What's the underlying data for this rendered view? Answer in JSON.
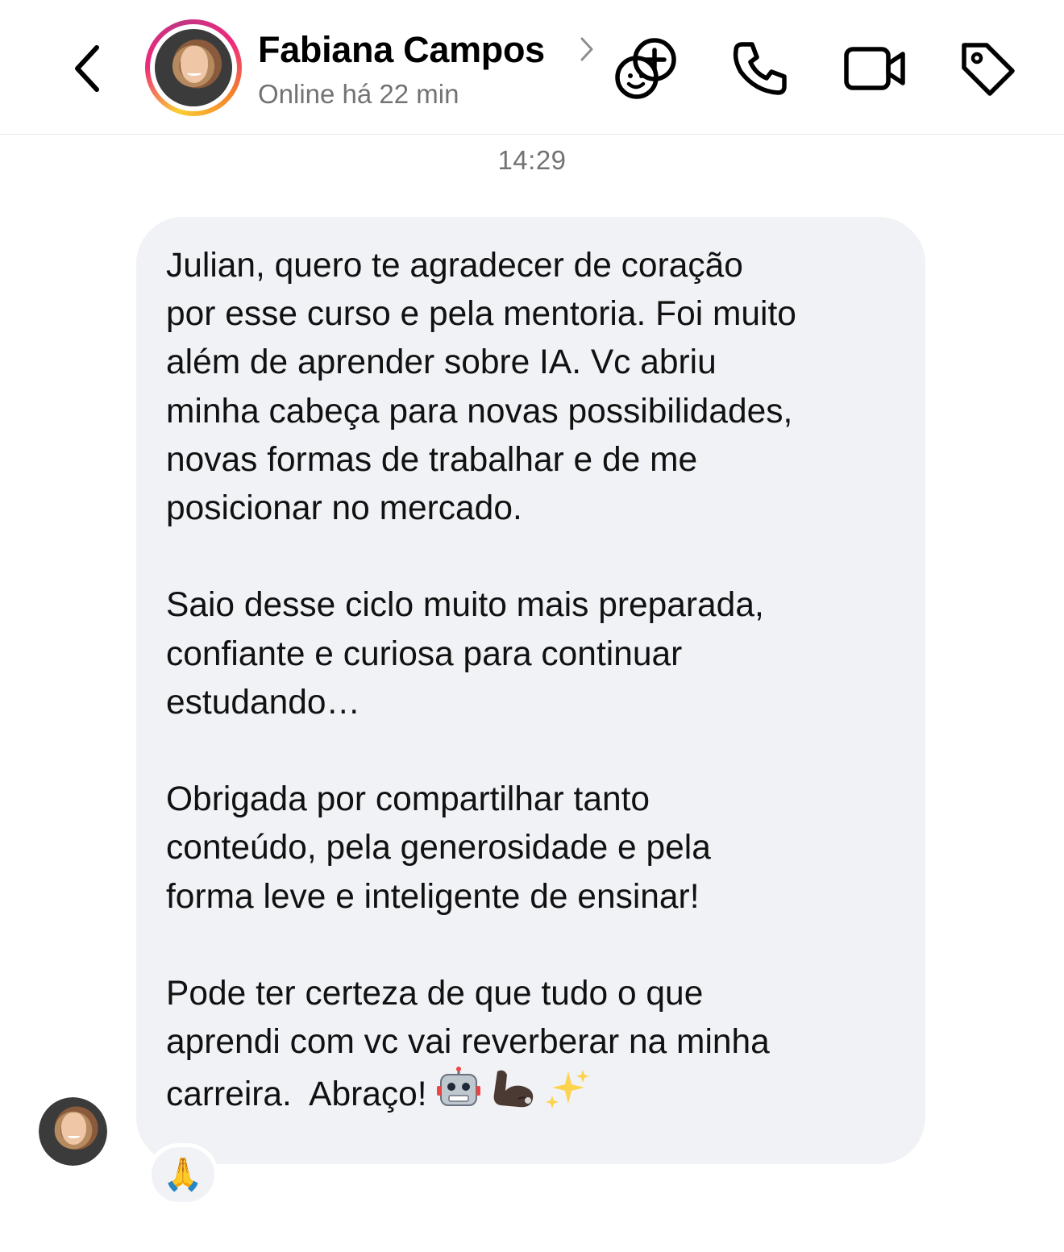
{
  "header": {
    "contact_name": "Fabiana Campos",
    "status": "Online há 22 min",
    "icons": [
      "chevron-left-icon",
      "chevron-right-icon",
      "add-to-group-icon",
      "phone-icon",
      "video-camera-icon",
      "tag-icon"
    ]
  },
  "conversation": {
    "timestamp": "14:29",
    "message": {
      "text": "Julian, quero te agradecer de coração\npor esse curso e pela mentoria. Foi muito\nalém de aprender sobre IA. Vc abriu\nminha cabeça para novas possibilidades,\nnovas formas de trabalhar e de me\nposicionar no mercado.\n\nSaio desse ciclo muito mais preparada,\nconfiante e curiosa para continuar\nestudando…\n\nObrigada por compartilhar tanto\nconteúdo, pela generosidade e pela\nforma leve e inteligente de ensinar!\n\nPode ter certeza de que tudo o que\naprendi com vc vai reverberar na minha\ncarreira.  Abraço! ",
      "emojis": [
        "robot-emoji",
        "flexed-biceps-emoji",
        "sparkles-emoji"
      ],
      "reaction": "🙏"
    }
  },
  "colors": {
    "bubble_bg": "#f1f2f5",
    "secondary_text": "#737373",
    "header_border": "#e9e9ec"
  }
}
